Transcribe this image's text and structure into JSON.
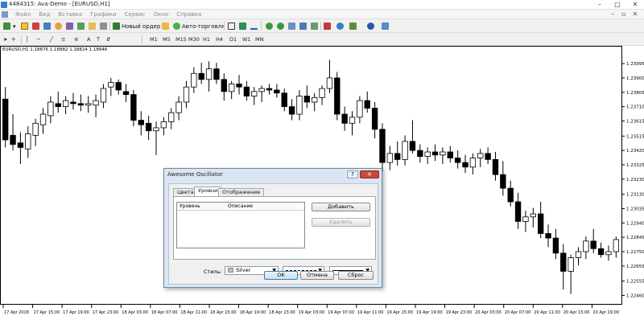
{
  "window": {
    "title": "4484315: Ava-Demo - [EURUSD,H1]",
    "controls": [
      "–",
      "□",
      "✕"
    ]
  },
  "menu": {
    "items": [
      "Файл",
      "Вид",
      "Вставка",
      "Графики",
      "Сервис",
      "Окно",
      "Справка"
    ],
    "mdi_controls": [
      "–",
      "▫",
      "✕"
    ]
  },
  "toolbar1": {
    "new_order_label": "Новый ордер",
    "autotrade_label": "Авто-торговля"
  },
  "toolbar2": {
    "timeframes": [
      "M1",
      "M5",
      "M15",
      "M30",
      "H1",
      "H4",
      "D1",
      "W1",
      "MN"
    ]
  },
  "chart": {
    "info": "EURUSD,H1  1.18876 1.18882 1.18824 1.18846"
  },
  "chart_data": {
    "type": "candlestick",
    "symbol": "EURUSD",
    "period": "H1",
    "price_ticks": [
      "1.23995",
      "1.23900",
      "1.23805",
      "1.23710",
      "1.23615",
      "1.23515",
      "1.23420",
      "1.23325",
      "1.23230",
      "1.23130",
      "1.23035",
      "1.22940",
      "1.22845",
      "1.22750",
      "1.22655",
      "1.22555",
      "1.22460"
    ],
    "time_ticks": [
      "17 Apr 2018",
      "17 Apr 15:00",
      "17 Apr 19:00",
      "17 Apr 23:00",
      "18 Apr 03:00",
      "18 Apr 07:00",
      "18 Apr 11:00",
      "18 Apr 15:00",
      "18 Apr 19:00",
      "18 Apr 23:00",
      "19 Apr 03:00",
      "19 Apr 07:00",
      "19 Apr 11:00",
      "19 Apr 15:00",
      "19 Apr 19:00",
      "19 Apr 23:00",
      "20 Apr 03:00",
      "20 Apr 07:00",
      "20 Apr 11:00",
      "20 Apr 15:00",
      "20 Apr 19:00"
    ],
    "ylim": [
      1.2242,
      1.2407
    ],
    "candles": [
      [
        1.2376,
        1.2384,
        1.2344,
        1.2349
      ],
      [
        1.2352,
        1.2366,
        1.2342,
        1.2346
      ],
      [
        1.2347,
        1.2354,
        1.2333,
        1.2344
      ],
      [
        1.2343,
        1.2358,
        1.2337,
        1.2353
      ],
      [
        1.2352,
        1.2363,
        1.2345,
        1.236
      ],
      [
        1.2359,
        1.237,
        1.2353,
        1.2366
      ],
      [
        1.2365,
        1.2378,
        1.236,
        1.2374
      ],
      [
        1.2373,
        1.2381,
        1.2367,
        1.2371
      ],
      [
        1.2371,
        1.2378,
        1.2366,
        1.2375
      ],
      [
        1.2374,
        1.238,
        1.2369,
        1.2373
      ],
      [
        1.2373,
        1.2379,
        1.2368,
        1.2372
      ],
      [
        1.2372,
        1.2378,
        1.2367,
        1.2373
      ],
      [
        1.2372,
        1.2379,
        1.2364,
        1.2375
      ],
      [
        1.2374,
        1.2386,
        1.237,
        1.2383
      ],
      [
        1.2384,
        1.239,
        1.2378,
        1.2387
      ],
      [
        1.2387,
        1.2389,
        1.2379,
        1.2382
      ],
      [
        1.2381,
        1.2386,
        1.2374,
        1.2379
      ],
      [
        1.2379,
        1.2382,
        1.2358,
        1.2362
      ],
      [
        1.2362,
        1.2368,
        1.2352,
        1.2359
      ],
      [
        1.236,
        1.2365,
        1.2349,
        1.2355
      ],
      [
        1.2355,
        1.2361,
        1.2339,
        1.2357
      ],
      [
        1.2357,
        1.2364,
        1.2352,
        1.2361
      ],
      [
        1.2361,
        1.237,
        1.2356,
        1.2367
      ],
      [
        1.2367,
        1.2378,
        1.2362,
        1.2374
      ],
      [
        1.2374,
        1.2388,
        1.237,
        1.2384
      ],
      [
        1.2384,
        1.2397,
        1.238,
        1.2393
      ],
      [
        1.2393,
        1.24,
        1.2386,
        1.2389
      ],
      [
        1.2389,
        1.2401,
        1.2381,
        1.2396
      ],
      [
        1.2396,
        1.24,
        1.2386,
        1.2389
      ],
      [
        1.2389,
        1.2393,
        1.2375,
        1.2381
      ],
      [
        1.2381,
        1.2388,
        1.2376,
        1.2386
      ],
      [
        1.2386,
        1.2392,
        1.2379,
        1.2384
      ],
      [
        1.2384,
        1.2388,
        1.2375,
        1.2378
      ],
      [
        1.2378,
        1.2384,
        1.2372,
        1.2381
      ],
      [
        1.2381,
        1.2385,
        1.2374,
        1.2383
      ],
      [
        1.2383,
        1.2386,
        1.2379,
        1.2382
      ],
      [
        1.2382,
        1.2386,
        1.2377,
        1.238
      ],
      [
        1.238,
        1.2383,
        1.2368,
        1.2371
      ],
      [
        1.2371,
        1.2376,
        1.2362,
        1.2366
      ],
      [
        1.2366,
        1.2382,
        1.2362,
        1.2378
      ],
      [
        1.2378,
        1.2385,
        1.237,
        1.2374
      ],
      [
        1.2374,
        1.238,
        1.2368,
        1.2377
      ],
      [
        1.2377,
        1.2385,
        1.2372,
        1.2383
      ],
      [
        1.2383,
        1.2402,
        1.238,
        1.239
      ],
      [
        1.239,
        1.2394,
        1.2362,
        1.2366
      ],
      [
        1.2366,
        1.2371,
        1.2355,
        1.236
      ],
      [
        1.236,
        1.2368,
        1.2352,
        1.2364
      ],
      [
        1.2364,
        1.2378,
        1.236,
        1.2375
      ],
      [
        1.2375,
        1.2381,
        1.2367,
        1.237
      ],
      [
        1.237,
        1.2374,
        1.235,
        1.2356
      ],
      [
        1.2356,
        1.236,
        1.2328,
        1.2334
      ],
      [
        1.2334,
        1.2345,
        1.2329,
        1.234
      ],
      [
        1.234,
        1.2348,
        1.2332,
        1.2336
      ],
      [
        1.2336,
        1.2352,
        1.2332,
        1.2348
      ],
      [
        1.2348,
        1.2362,
        1.234,
        1.2342
      ],
      [
        1.2342,
        1.2346,
        1.2334,
        1.2338
      ],
      [
        1.2338,
        1.2344,
        1.2333,
        1.2341
      ],
      [
        1.2341,
        1.2346,
        1.2335,
        1.2339
      ],
      [
        1.2339,
        1.2344,
        1.2333,
        1.2341
      ],
      [
        1.2341,
        1.2345,
        1.2334,
        1.2337
      ],
      [
        1.2337,
        1.2342,
        1.233,
        1.2334
      ],
      [
        1.2334,
        1.2339,
        1.2327,
        1.2331
      ],
      [
        1.2331,
        1.234,
        1.2326,
        1.2337
      ],
      [
        1.2337,
        1.2343,
        1.2331,
        1.234
      ],
      [
        1.234,
        1.2344,
        1.2333,
        1.2336
      ],
      [
        1.2336,
        1.2341,
        1.2322,
        1.2326
      ],
      [
        1.2326,
        1.2335,
        1.2312,
        1.2317
      ],
      [
        1.2317,
        1.2322,
        1.2305,
        1.2308
      ],
      [
        1.2308,
        1.2314,
        1.229,
        1.2295
      ],
      [
        1.2295,
        1.2302,
        1.2288,
        1.2298
      ],
      [
        1.2298,
        1.2304,
        1.2291,
        1.23
      ],
      [
        1.23,
        1.2308,
        1.2284,
        1.2287
      ],
      [
        1.2287,
        1.2293,
        1.2278,
        1.2284
      ],
      [
        1.2284,
        1.229,
        1.227,
        1.2274
      ],
      [
        1.2274,
        1.228,
        1.225,
        1.2262
      ],
      [
        1.2262,
        1.2273,
        1.2247,
        1.2271
      ],
      [
        1.2271,
        1.2278,
        1.2266,
        1.2275
      ],
      [
        1.2275,
        1.2285,
        1.227,
        1.2282
      ],
      [
        1.2282,
        1.229,
        1.2274,
        1.2277
      ],
      [
        1.2277,
        1.2281,
        1.2271,
        1.2273
      ],
      [
        1.2273,
        1.2279,
        1.2269,
        1.2275
      ],
      [
        1.2275,
        1.2285,
        1.2271,
        1.2283
      ]
    ]
  },
  "dialog": {
    "title": "Awesome Oscillator",
    "help": "?",
    "close": "✕",
    "tabs": [
      "Цвета",
      "Уровни",
      "Отображение"
    ],
    "active_tab": "Уровни",
    "levels_columns": [
      "Уровень",
      "Описание"
    ],
    "add_button": "Добавить",
    "delete_button": "Удалить",
    "style_label": "Стиль:",
    "style_color": "Silver",
    "ok": "OK",
    "cancel": "Отмена",
    "reset": "Сброс"
  },
  "colors": {
    "bull": "#ffffff",
    "bear": "#000000"
  }
}
